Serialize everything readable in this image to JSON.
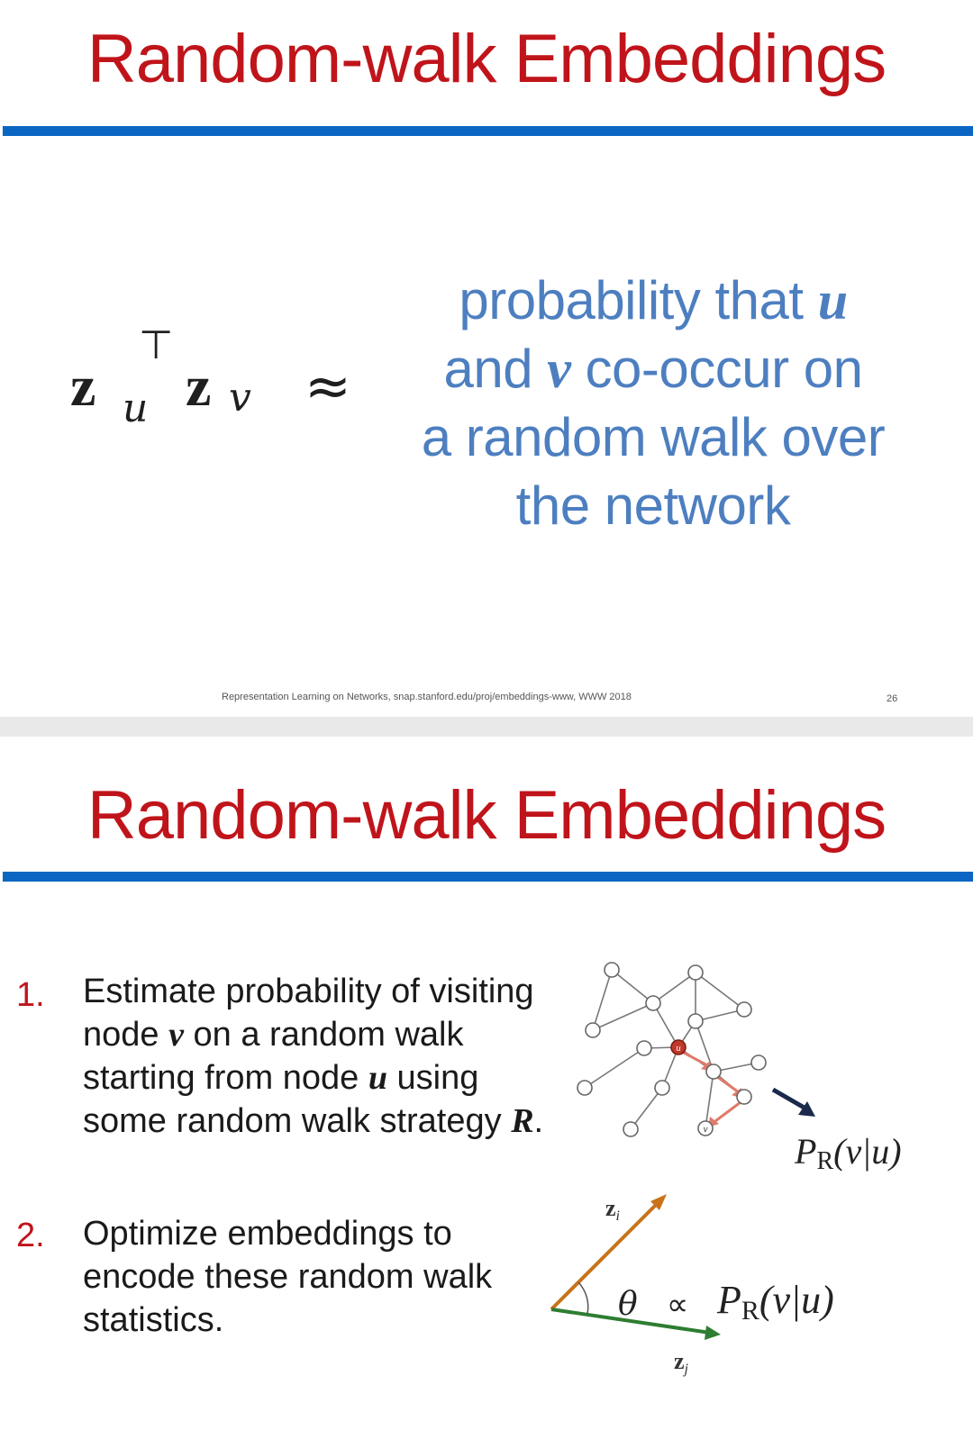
{
  "slide1": {
    "title": "Random-walk Embeddings",
    "formula": {
      "lhs_a": "z",
      "lhs_a_sub": "u",
      "lhs_a_sup": "⊤",
      "lhs_b": "z",
      "lhs_b_sub": "v",
      "relation": "≈"
    },
    "description": {
      "part1": "probability that ",
      "var_u": "u",
      "part2": "and ",
      "var_v": "v",
      "part3": " co-occur on",
      "line3": "a random walk over",
      "line4": "the network"
    },
    "footer": "Representation Learning on Networks, snap.stanford.edu/proj/embeddings-www, WWW 2018",
    "page_number": "26"
  },
  "slide2": {
    "title": "Random-walk Embeddings",
    "steps": [
      {
        "number": "1.",
        "t1": "Estimate probability of visiting node ",
        "v": "v",
        "t2": " on a random walk starting from node ",
        "u": "u",
        "t3": " using some random walk strategy ",
        "R": "R",
        "t4": "."
      },
      {
        "number": "2.",
        "text": "Optimize embeddings to encode these random walk statistics."
      }
    ],
    "graph_label": "P",
    "graph_label_sub": "R",
    "graph_label_arg": "(v|u)",
    "graph_node_u": "u",
    "graph_node_v": "v",
    "vec_i": "z",
    "vec_i_sub": "i",
    "vec_j": "z",
    "vec_j_sub": "j",
    "theta": "θ",
    "prop": "∝",
    "vec_P": "P",
    "vec_P_sub": "R",
    "vec_P_arg": "(v|u)",
    "colors": {
      "title": "#c0141b",
      "rule": "#0b66c3",
      "desc": "#4d7fc0",
      "walk": "#e07a6a",
      "node_u": "#c0392b",
      "arrow_dark": "#1b2a4a",
      "vec_i": "#c8721a",
      "vec_j": "#2e7d32"
    }
  }
}
